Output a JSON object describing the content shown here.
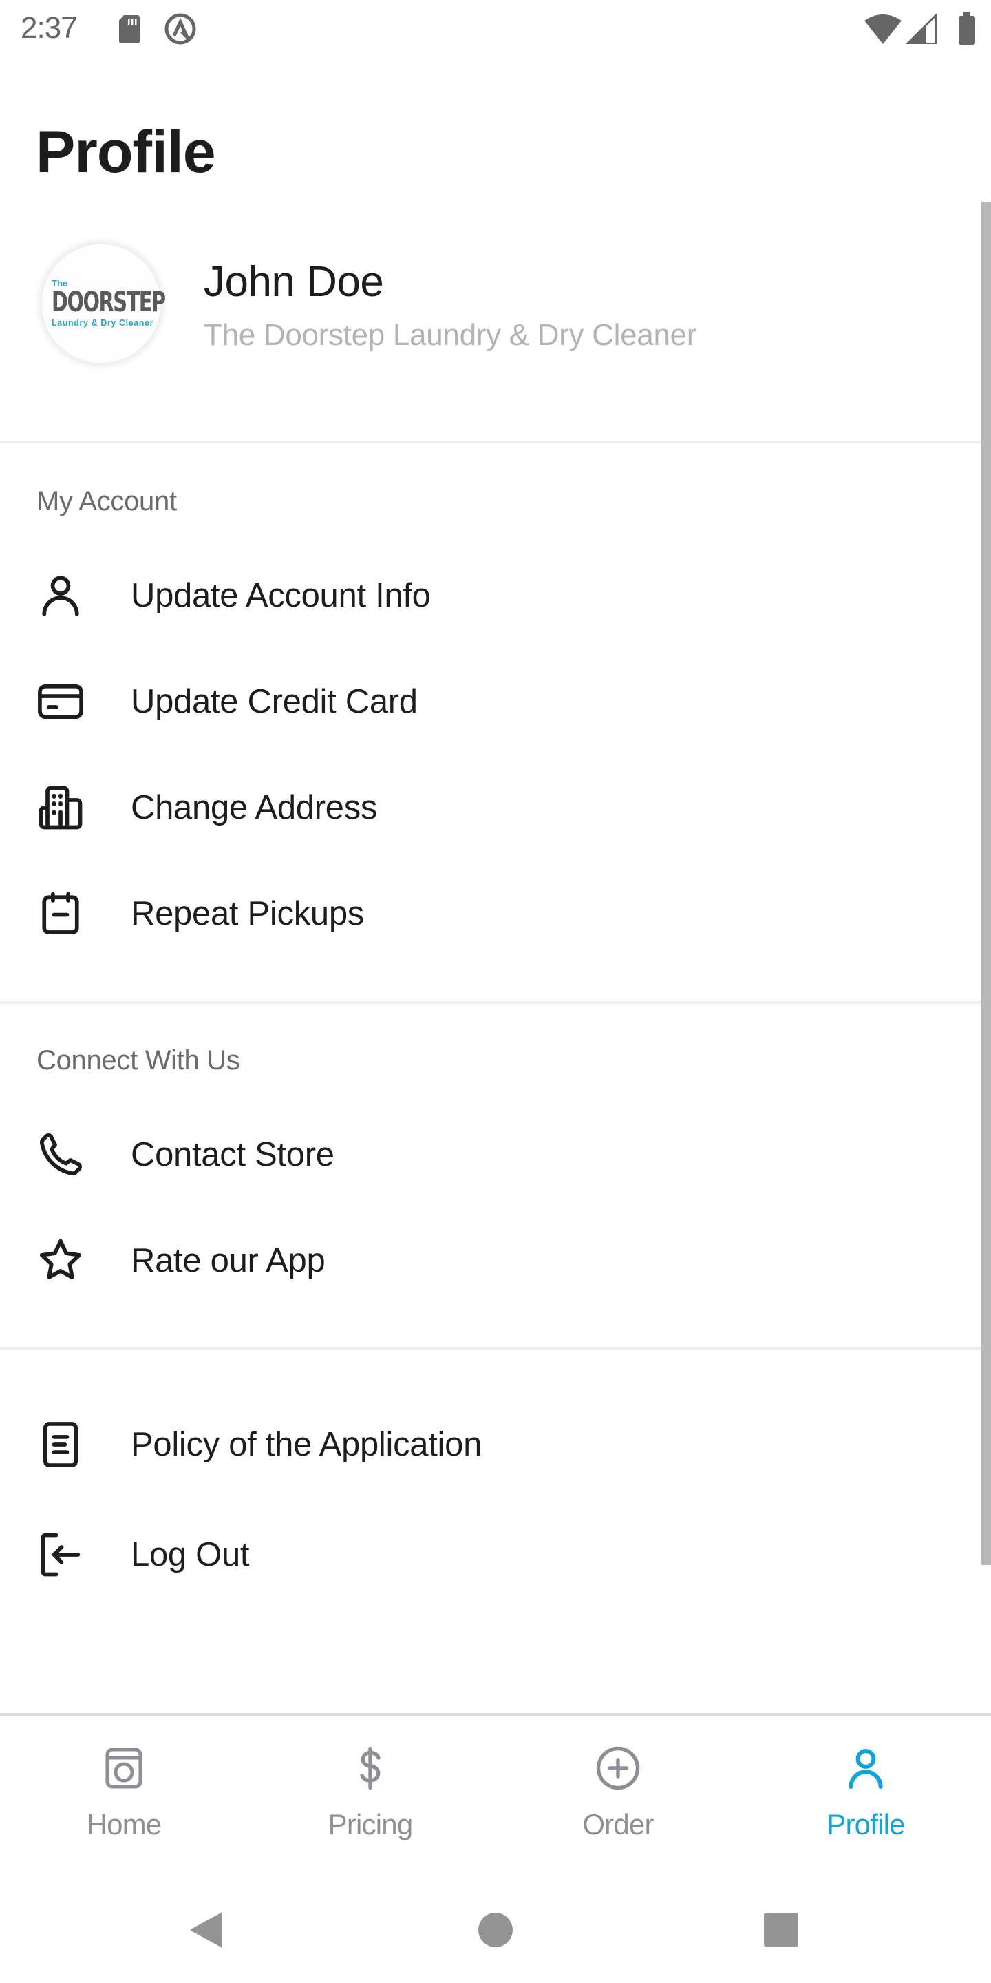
{
  "status_bar": {
    "time": "2:37",
    "icons": [
      "sd-card-icon",
      "accessibility-a-icon",
      "wifi-icon",
      "cell-signal-icon",
      "battery-icon"
    ]
  },
  "page": {
    "title": "Profile"
  },
  "profile": {
    "name": "John Doe",
    "store": "The Doorstep Laundry & Dry Cleaner",
    "logo": {
      "prefix": "The",
      "main": "DOORSTEP",
      "tagline": "Laundry & Dry Cleaner"
    }
  },
  "sections": [
    {
      "header": "My Account",
      "items": [
        {
          "label": "Update Account Info",
          "icon": "user-icon"
        },
        {
          "label": "Update Credit Card",
          "icon": "credit-card-icon"
        },
        {
          "label": "Change Address",
          "icon": "building-icon"
        },
        {
          "label": "Repeat Pickups",
          "icon": "calendar-icon"
        }
      ]
    },
    {
      "header": "Connect With Us",
      "items": [
        {
          "label": "Contact Store",
          "icon": "phone-icon"
        },
        {
          "label": "Rate our App",
          "icon": "star-icon"
        }
      ]
    },
    {
      "header": "",
      "items": [
        {
          "label": "Policy of the Application",
          "icon": "document-icon"
        },
        {
          "label": "Log Out",
          "icon": "logout-icon"
        }
      ]
    }
  ],
  "bottom_nav": {
    "active": "Profile",
    "tabs": [
      {
        "label": "Home",
        "icon": "washing-machine-icon"
      },
      {
        "label": "Pricing",
        "icon": "dollar-icon"
      },
      {
        "label": "Order",
        "icon": "add-circle-icon"
      },
      {
        "label": "Profile",
        "icon": "user-icon"
      }
    ]
  },
  "colors": {
    "accent": "#10a5d6",
    "text_primary": "#1d1d20",
    "text_secondary": "#6b6b6b",
    "text_muted": "#b3b3b3",
    "tab_inactive": "#8e8e96",
    "divider": "#eeeeee"
  }
}
